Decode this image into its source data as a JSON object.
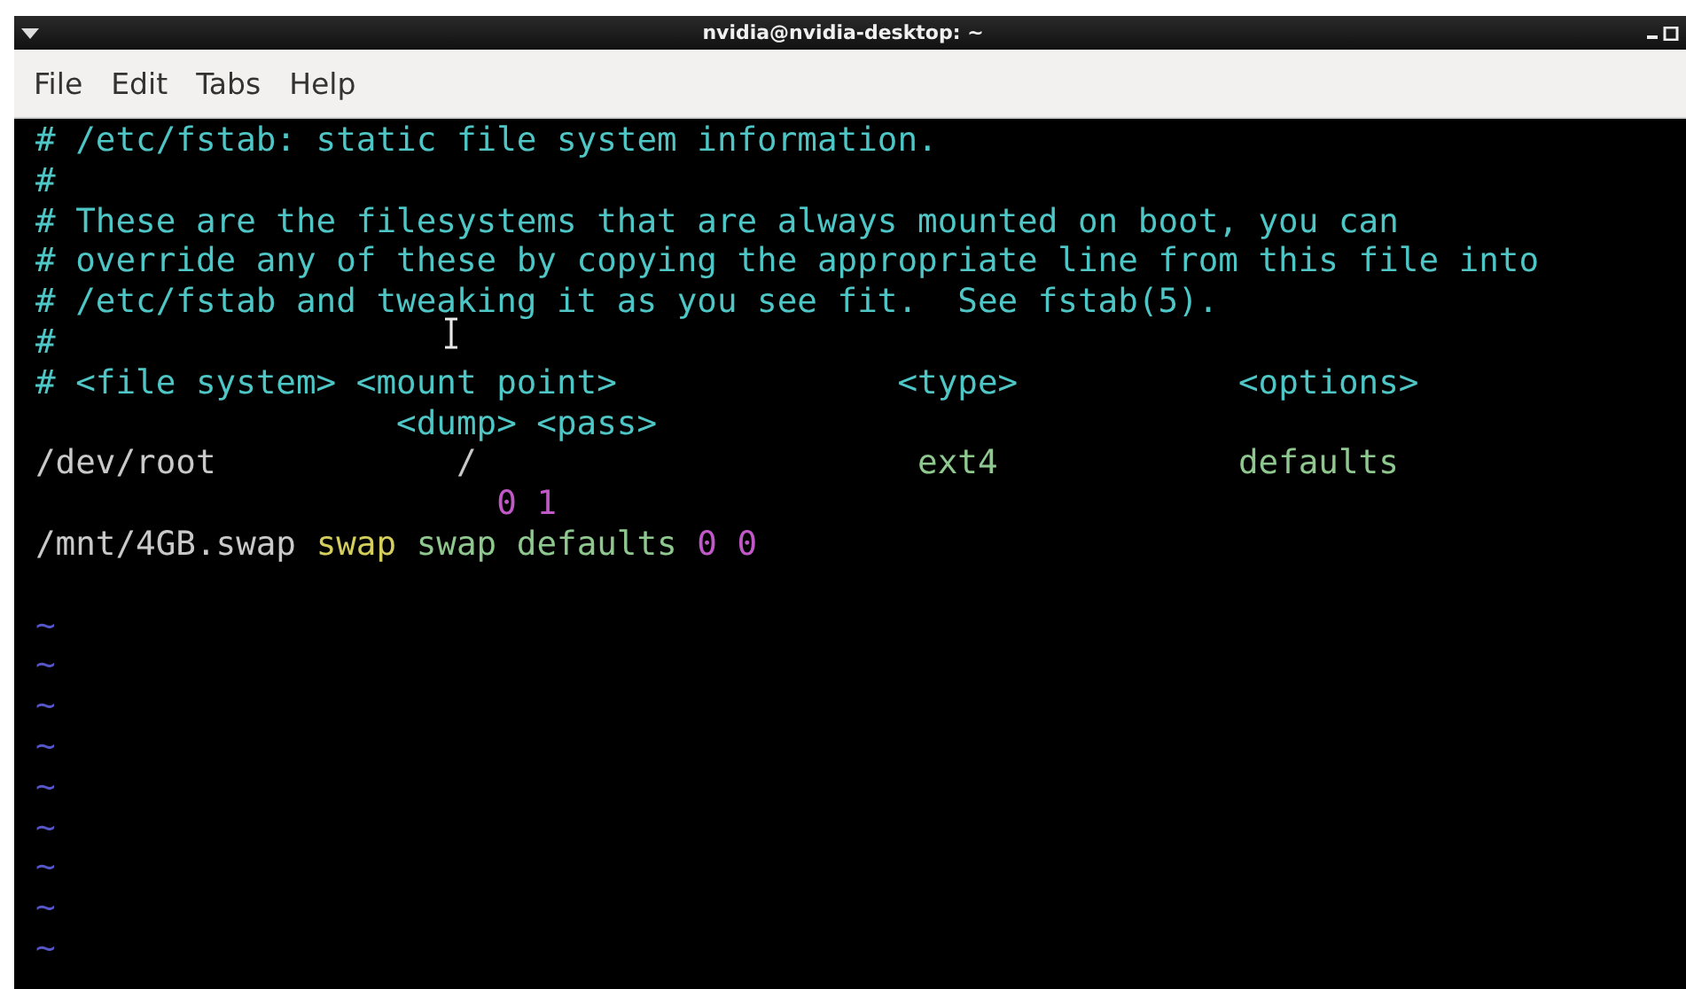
{
  "window": {
    "title": "nvidia@nvidia-desktop: ~"
  },
  "menu": [
    "File",
    "Edit",
    "Tabs",
    "Help"
  ],
  "lines": [
    {
      "segments": [
        {
          "kind": "comment",
          "text": "# /etc/fstab: static file system information."
        }
      ]
    },
    {
      "segments": [
        {
          "kind": "comment",
          "text": "#"
        }
      ]
    },
    {
      "segments": [
        {
          "kind": "comment",
          "text": "# These are the filesystems that are always mounted on boot, you can"
        }
      ]
    },
    {
      "segments": [
        {
          "kind": "comment",
          "text": "# override any of these by copying the appropriate line from this file into"
        }
      ]
    },
    {
      "segments": [
        {
          "kind": "comment",
          "text": "# /etc/fstab and tweaking it as you see fit.  See fstab(5)."
        }
      ]
    },
    {
      "segments": [
        {
          "kind": "comment",
          "text": "#"
        }
      ]
    },
    {
      "segments": [
        {
          "kind": "comment",
          "text": "# <file system> <mount point>"
        },
        {
          "kind": "comment",
          "text": "<type>"
        },
        {
          "kind": "comment",
          "text": "<options>"
        }
      ]
    },
    {
      "segments": [
        {
          "kind": "comment",
          "text": "<dump> <pass>"
        }
      ]
    },
    {
      "segments": [
        {
          "kind": "normal",
          "text": "/dev/root"
        },
        {
          "kind": "normal",
          "text": "/"
        },
        {
          "kind": "value",
          "text": "ext4"
        },
        {
          "kind": "value",
          "text": "defaults"
        }
      ]
    },
    {
      "segments": [
        {
          "kind": "number",
          "text": "0 1"
        }
      ]
    },
    {
      "segments": [
        {
          "kind": "normal",
          "text": "/mnt/4GB.swap"
        },
        {
          "kind": "keyword",
          "text": "swap"
        },
        {
          "kind": "value",
          "text": "swap defaults"
        },
        {
          "kind": "number",
          "text": "0 0"
        }
      ]
    }
  ],
  "tildes": [
    "~",
    "~",
    "~",
    "~",
    "~",
    "~",
    "~",
    "~",
    "~"
  ]
}
